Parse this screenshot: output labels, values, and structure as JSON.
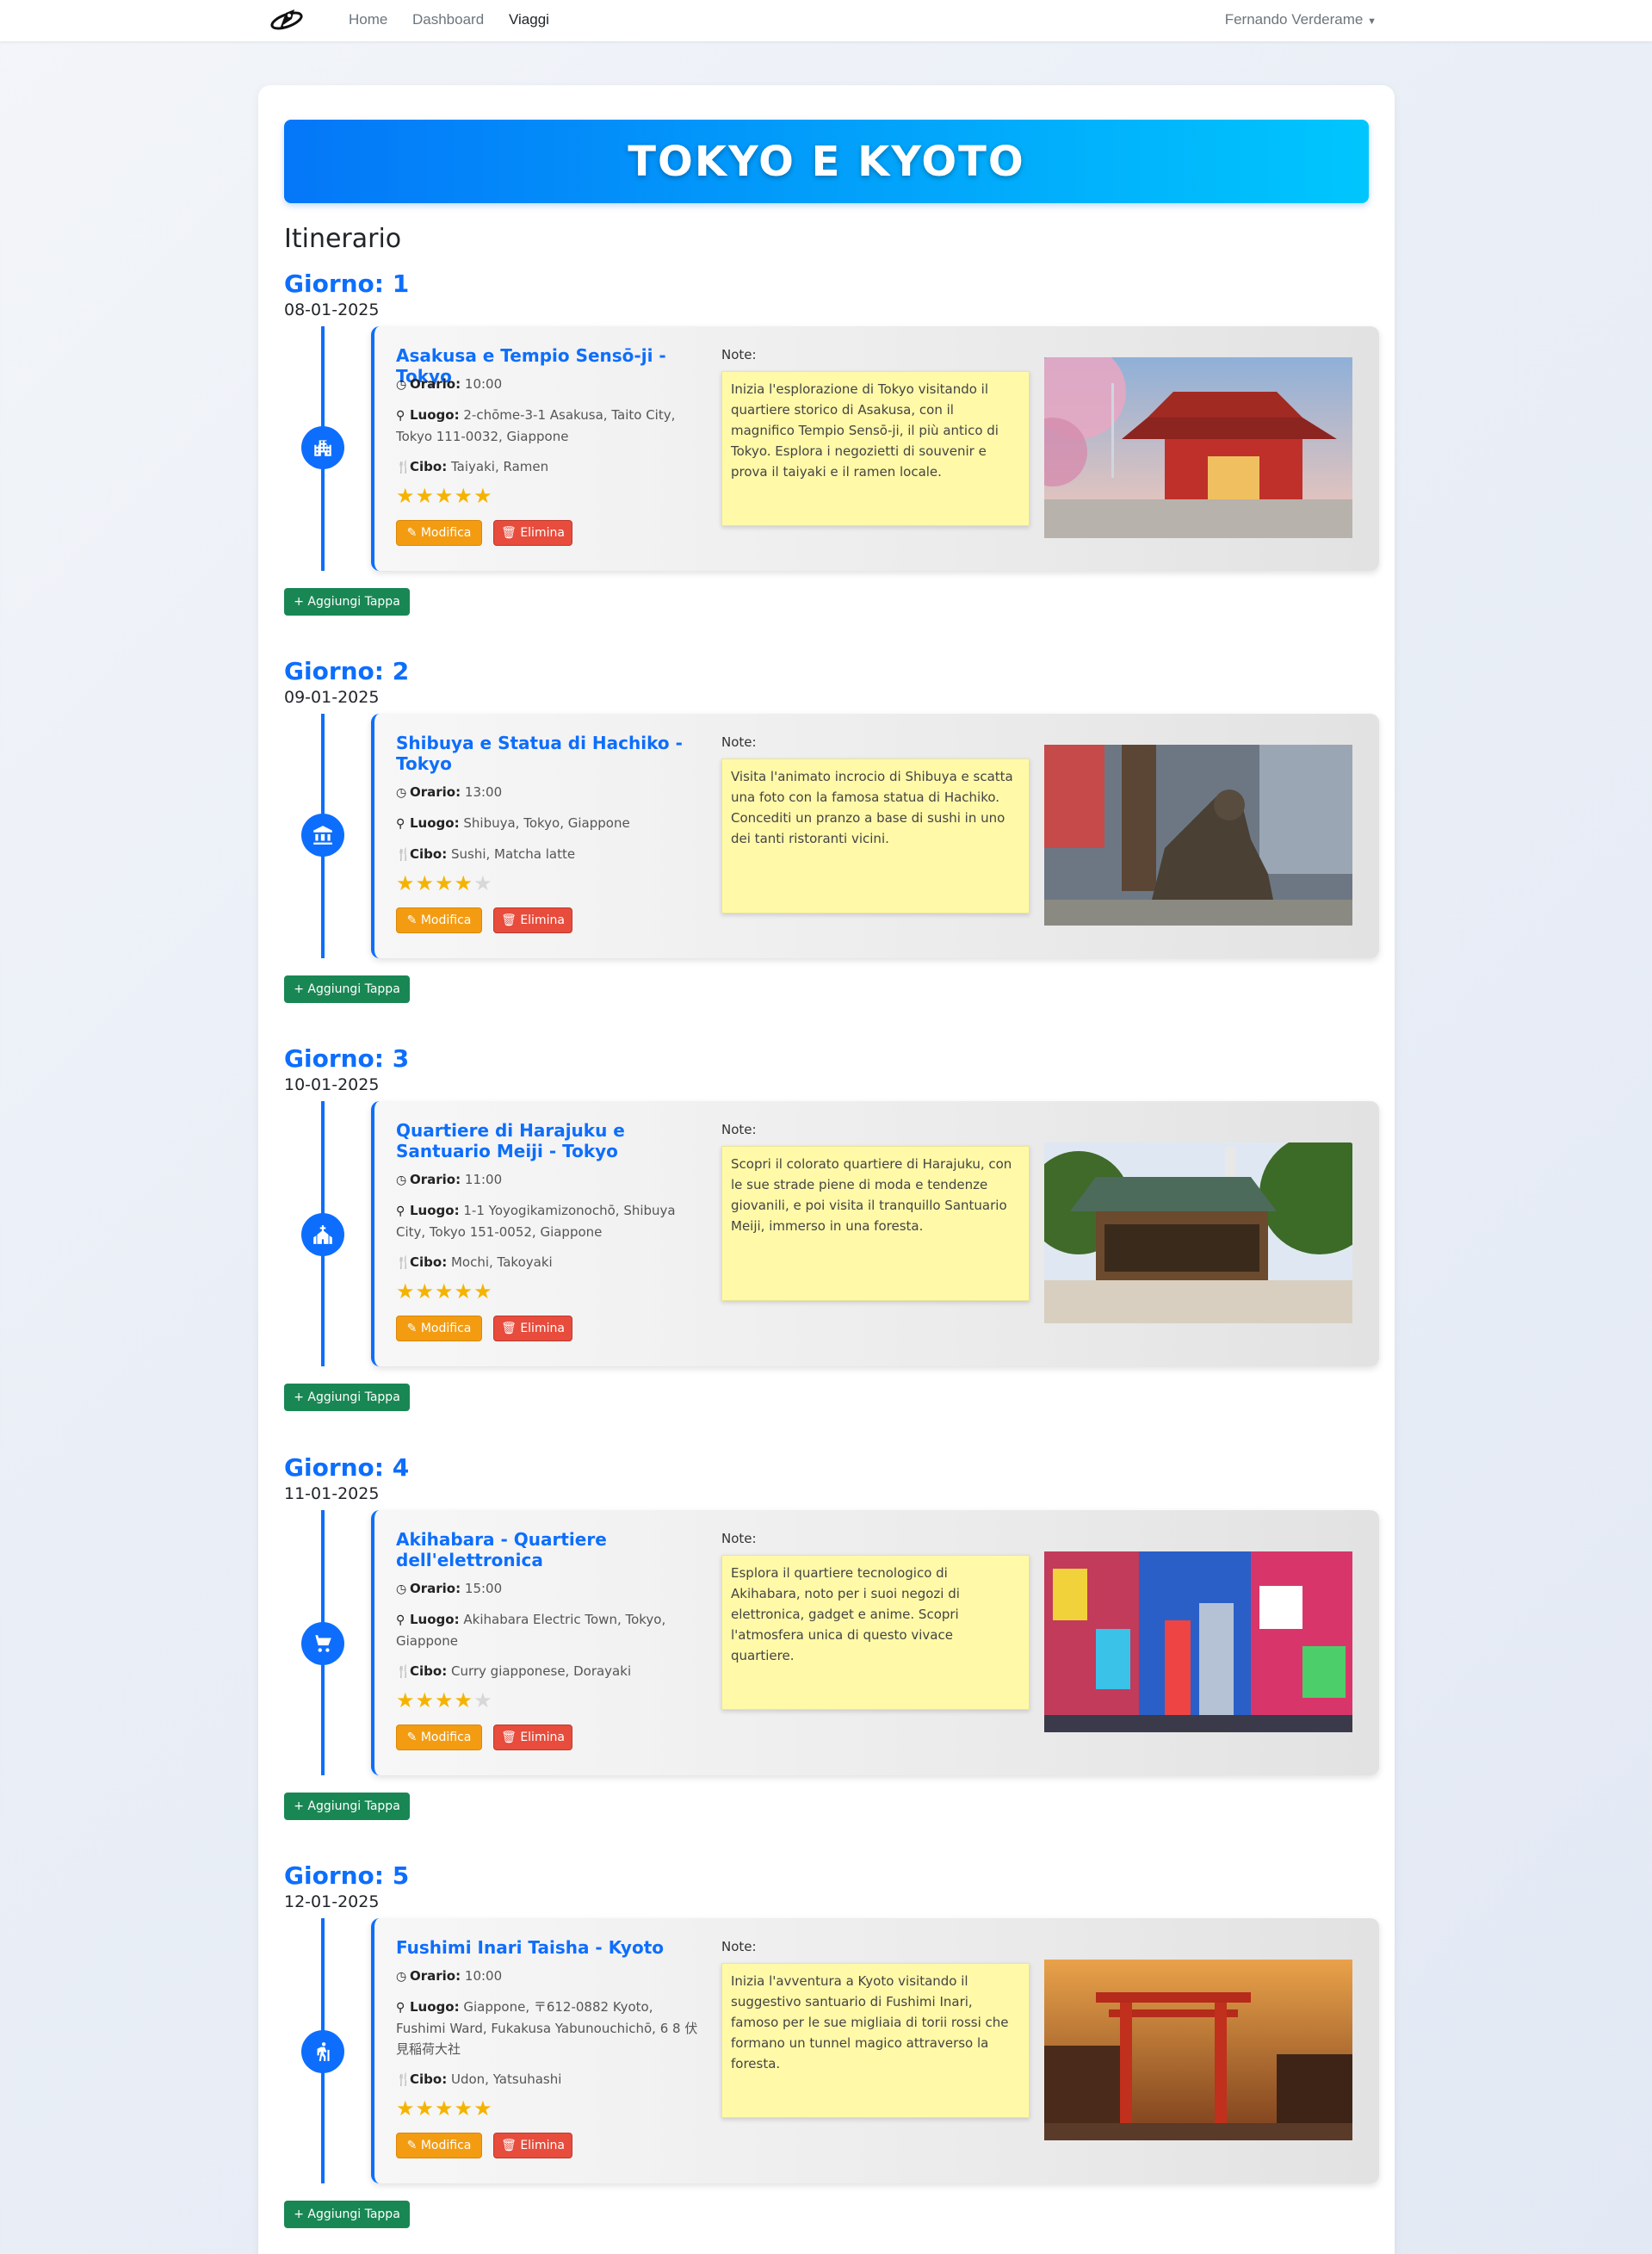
{
  "nav": {
    "logo": "rocket-logo",
    "links": [
      "Home",
      "Dashboard",
      "Viaggi"
    ],
    "active": "Viaggi",
    "user": "Fernando Verderame"
  },
  "trip": {
    "title": "TOKYO E KYOTO",
    "section": "Itinerario"
  },
  "labels": {
    "orario": "Orario:",
    "luogo": "Luogo:",
    "cibo": "Cibo:",
    "note": "Note:",
    "modifica": "Modifica",
    "elimina": "Elimina",
    "add_stop": "Aggiungi Tappa"
  },
  "days": [
    {
      "title": "Giorno: 1",
      "date": "08-01-2025",
      "icon": "building-icon",
      "stop": {
        "title": "Asakusa e Tempio Sensō-ji - Tokyo",
        "time": "10:00",
        "place": "2-chōme-3-1 Asakusa, Taito City, Tokyo 111-0032, Giappone",
        "food": "Taiyaki, Ramen",
        "rating": 5,
        "note": "Inizia l'esplorazione di Tokyo visitando il quartiere storico di Asakusa, con il magnifico Tempio Sensō-ji, il più antico di Tokyo. Esplora i negozietti di souvenir e prova il taiyaki e il ramen locale.",
        "photo": "temple-photo"
      }
    },
    {
      "title": "Giorno: 2",
      "date": "09-01-2025",
      "icon": "landmark-icon",
      "stop": {
        "title": "Shibuya e Statua di Hachiko - Tokyo",
        "time": "13:00",
        "place": "Shibuya, Tokyo, Giappone",
        "food": "Sushi, Matcha latte",
        "rating": 4,
        "note": "Visita l'animato incrocio di Shibuya e scatta una foto con la famosa statua di Hachiko. Concediti un pranzo a base di sushi in uno dei tanti ristoranti vicini.",
        "photo": "hachiko-photo"
      }
    },
    {
      "title": "Giorno: 3",
      "date": "10-01-2025",
      "icon": "church-icon",
      "stop": {
        "title": "Quartiere di Harajuku e Santuario Meiji - Tokyo",
        "time": "11:00",
        "place": "1-1 Yoyogikamizonochō, Shibuya City, Tokyo 151-0052, Giappone",
        "food": "Mochi, Takoyaki",
        "rating": 5,
        "note": "Scopri il colorato quartiere di Harajuku, con le sue strade piene di moda e tendenze giovanili, e poi visita il tranquillo Santuario Meiji, immerso in una foresta.",
        "photo": "shrine-photo"
      }
    },
    {
      "title": "Giorno: 4",
      "date": "11-01-2025",
      "icon": "cart-icon",
      "stop": {
        "title": "Akihabara - Quartiere dell'elettronica",
        "time": "15:00",
        "place": "Akihabara Electric Town, Tokyo, Giappone",
        "food": "Curry giapponese, Dorayaki",
        "rating": 4,
        "note": "Esplora il quartiere tecnologico di Akihabara, noto per i suoi negozi di elettronica, gadget e anime. Scopri l'atmosfera unica di questo vivace quartiere.",
        "photo": "akihabara-photo"
      }
    },
    {
      "title": "Giorno: 5",
      "date": "12-01-2025",
      "icon": "hiking-icon",
      "stop": {
        "title": "Fushimi Inari Taisha - Kyoto",
        "time": "10:00",
        "place": "Giappone, 〒612-0882 Kyoto, Fushimi Ward, Fukakusa Yabunouchichō, 6 8 伏見稲荷大社",
        "food": "Udon, Yatsuhashi",
        "rating": 5,
        "note": "Inizia l'avventura a Kyoto visitando il suggestivo santuario di Fushimi Inari, famoso per le sue migliaia di torii rossi che formano un tunnel magico attraverso la foresta.",
        "photo": "torii-photo"
      }
    }
  ]
}
